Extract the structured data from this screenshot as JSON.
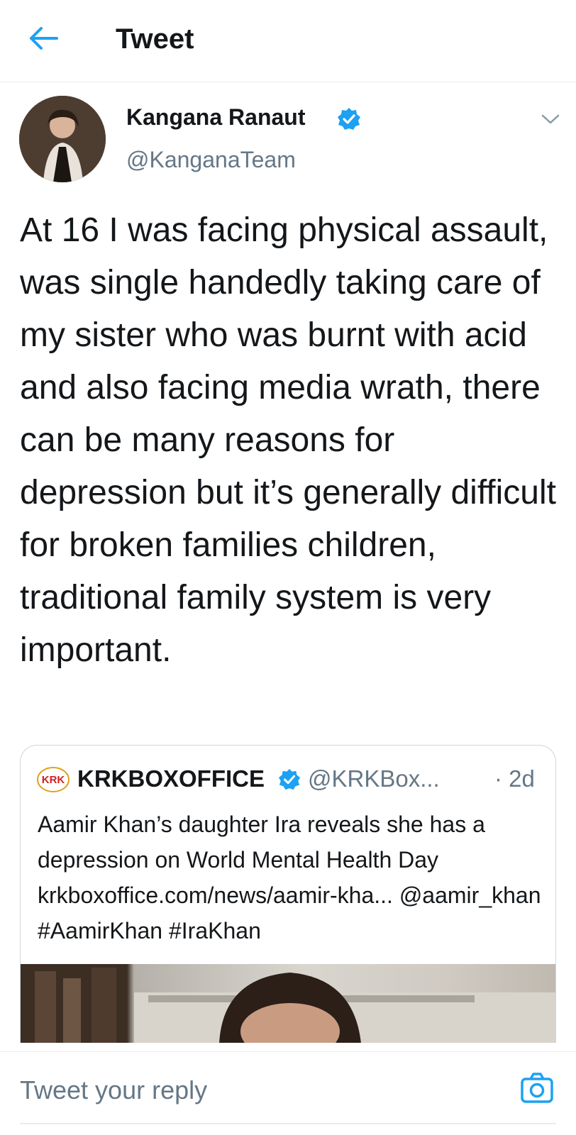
{
  "header": {
    "title": "Tweet",
    "back_icon": "arrow-left-icon"
  },
  "tweet": {
    "author_name": "Kangana Ranaut",
    "author_handle": "@KanganaTeam",
    "verified": true,
    "text": "At 16 I was facing physical assault, was single handedly taking care of my sister who was burnt with acid and also facing media wrath, there can be many reasons for depression but it’s generally difficult for broken families children, traditional family system is very important.",
    "menu_icon": "chevron-down-icon"
  },
  "quoted_tweet": {
    "logo_text": "KRK",
    "author_name": "KRKBOXOFFICE",
    "author_handle": "@KRKBox...",
    "verified": true,
    "time": "· 2d",
    "text": "Aamir Khan’s daughter Ira reveals she has a depression on World Mental Health Day krkboxoffice.com/news/aamir-kha... @aamir_khan #AamirKhan #IraKhan"
  },
  "reply": {
    "placeholder": "Tweet your reply",
    "camera_icon": "camera-icon"
  },
  "colors": {
    "accent": "#1da1f2",
    "text": "#14171a",
    "secondary": "#657786",
    "border": "#e6ecf0"
  }
}
